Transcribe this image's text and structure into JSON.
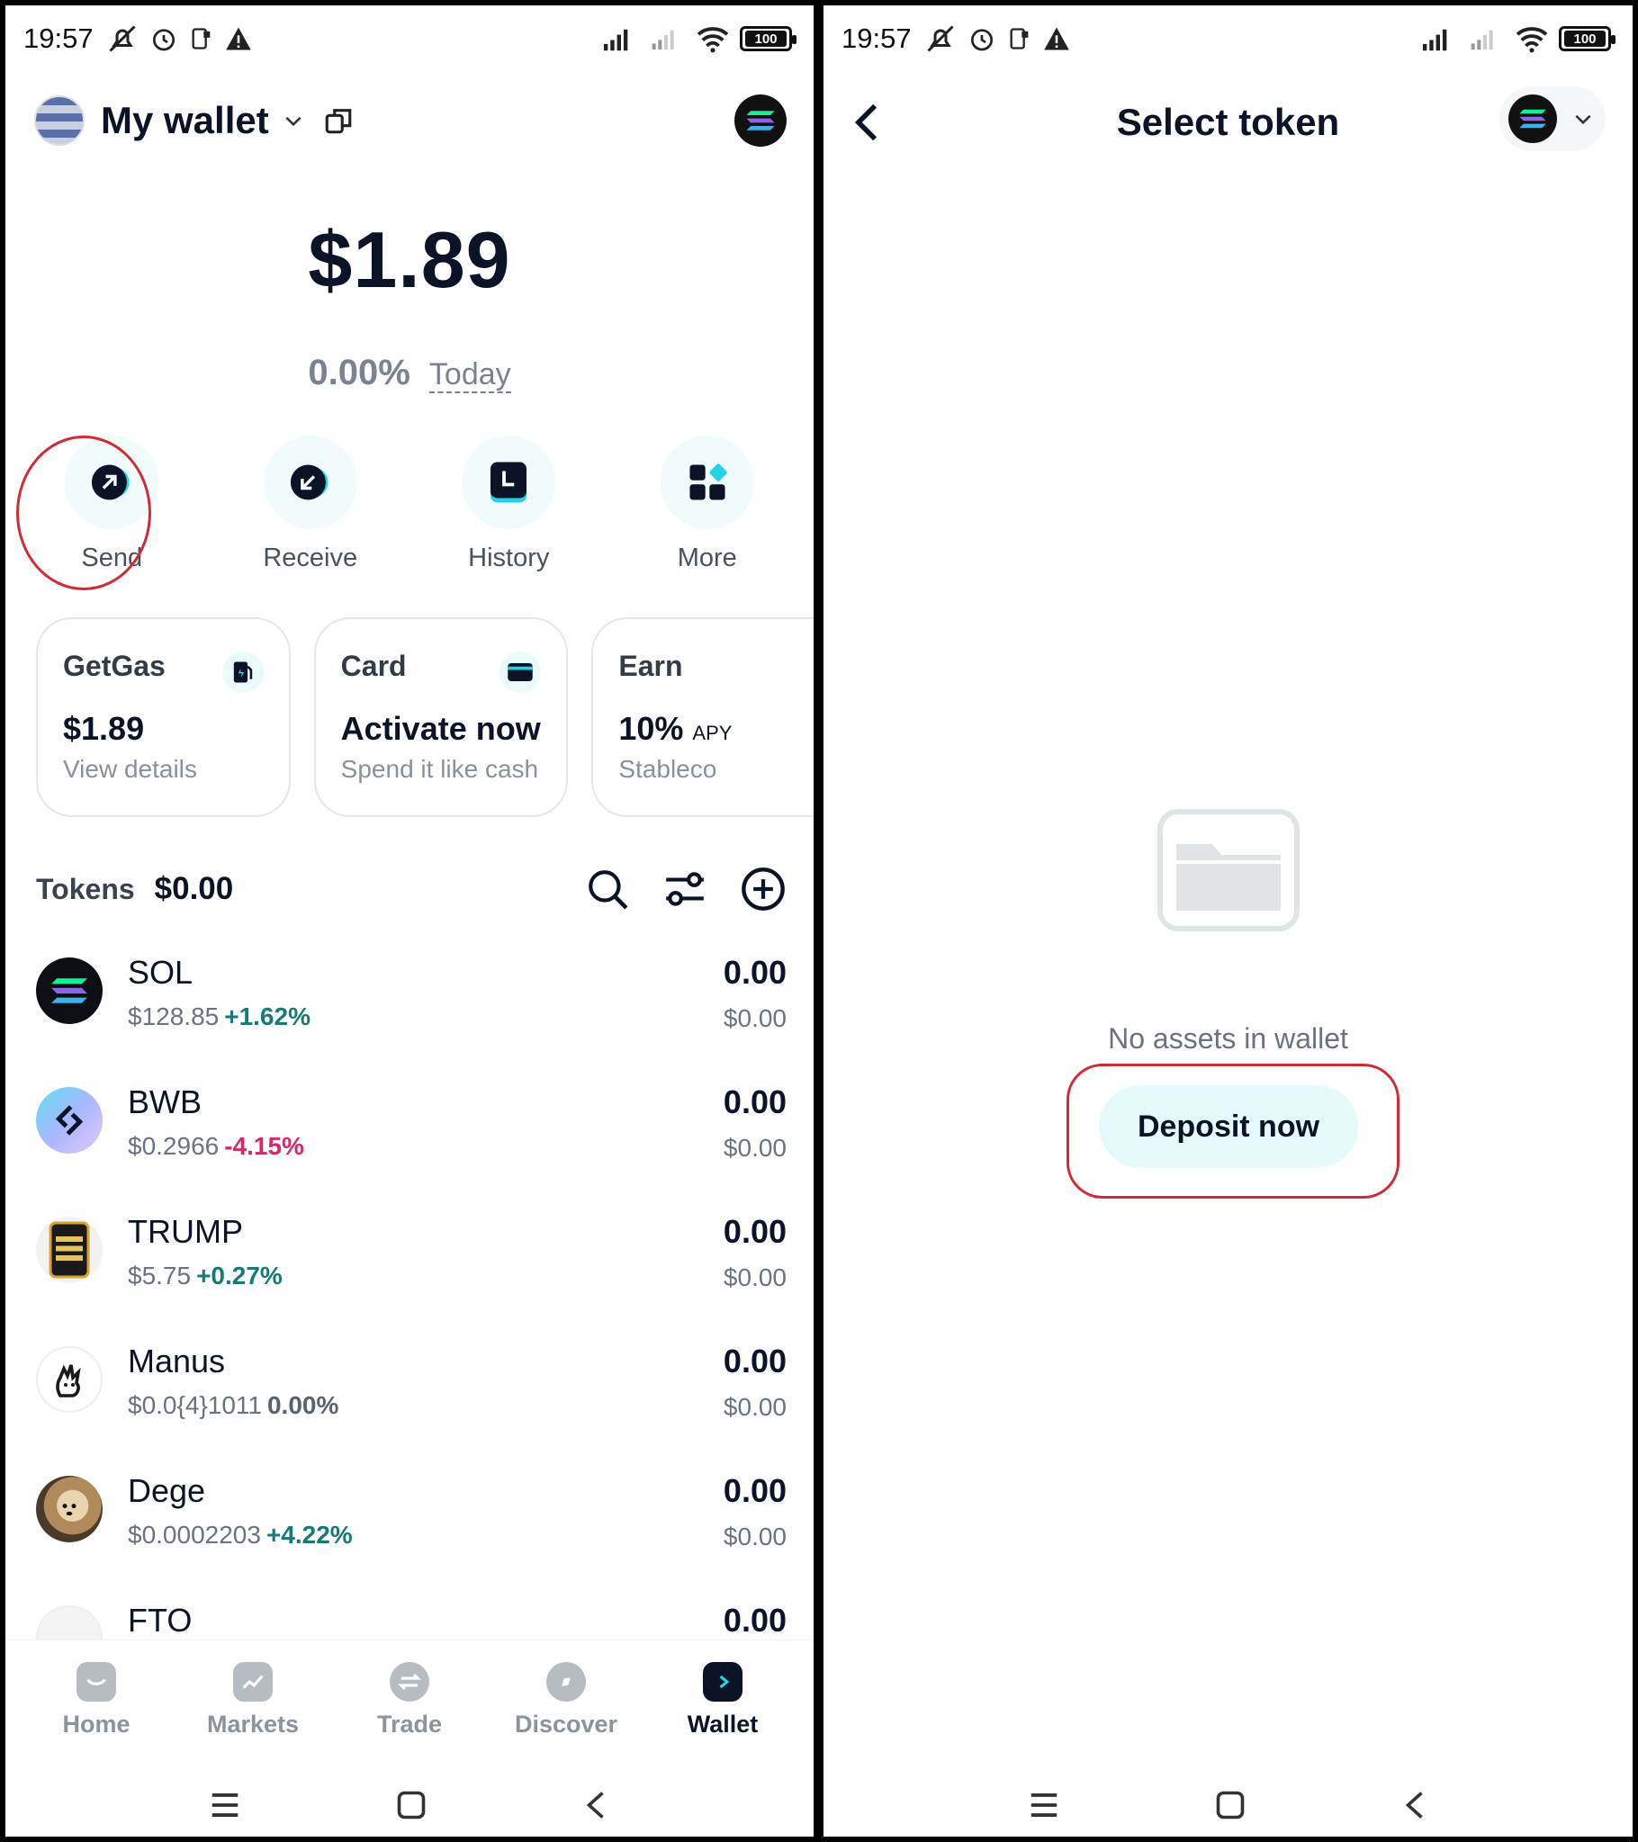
{
  "status": {
    "time": "19:57",
    "battery": "100"
  },
  "left": {
    "wallet_title": "My wallet",
    "balance": "$1.89",
    "change_pct": "0.00%",
    "change_period": "Today",
    "actions": [
      {
        "label": "Send",
        "icon": "arrow-up-right-icon"
      },
      {
        "label": "Receive",
        "icon": "arrow-down-left-icon"
      },
      {
        "label": "History",
        "icon": "clock-icon"
      },
      {
        "label": "More",
        "icon": "grid-icon"
      }
    ],
    "cards": [
      {
        "title": "GetGas",
        "main": "$1.89",
        "sub": "View details"
      },
      {
        "title": "Card",
        "main": "Activate now",
        "sub": "Spend it like cash"
      },
      {
        "title": "Earn",
        "main": "10%",
        "main_suffix": "APY",
        "sub": "Stableco"
      }
    ],
    "tokens_label": "Tokens",
    "tokens_total": "$0.00",
    "tokens": [
      {
        "name": "SOL",
        "price": "$128.85",
        "change": "+1.62%",
        "amount": "0.00",
        "usd": "$0.00"
      },
      {
        "name": "BWB",
        "price": "$0.2966",
        "change": "-4.15%",
        "amount": "0.00",
        "usd": "$0.00"
      },
      {
        "name": "TRUMP",
        "price": "$5.75",
        "change": "+0.27%",
        "amount": "0.00",
        "usd": "$0.00"
      },
      {
        "name": "Manus",
        "price": "$0.0{4}1011",
        "change": "0.00%",
        "amount": "0.00",
        "usd": "$0.00"
      },
      {
        "name": "Dege",
        "price": "$0.0002203",
        "change": "+4.22%",
        "amount": "0.00",
        "usd": "$0.00"
      },
      {
        "name": "FTO",
        "price": "",
        "change": "",
        "amount": "0.00",
        "usd": ""
      }
    ],
    "nav": [
      {
        "label": "Home"
      },
      {
        "label": "Markets"
      },
      {
        "label": "Trade"
      },
      {
        "label": "Discover"
      },
      {
        "label": "Wallet"
      }
    ]
  },
  "right": {
    "title": "Select token",
    "empty_text": "No assets in wallet",
    "deposit_label": "Deposit now"
  },
  "colors": {
    "accent": "#0b1426",
    "positive": "#177a75",
    "negative": "#d6296a",
    "annotation": "#d12b36",
    "mint": "#e6fafb"
  }
}
